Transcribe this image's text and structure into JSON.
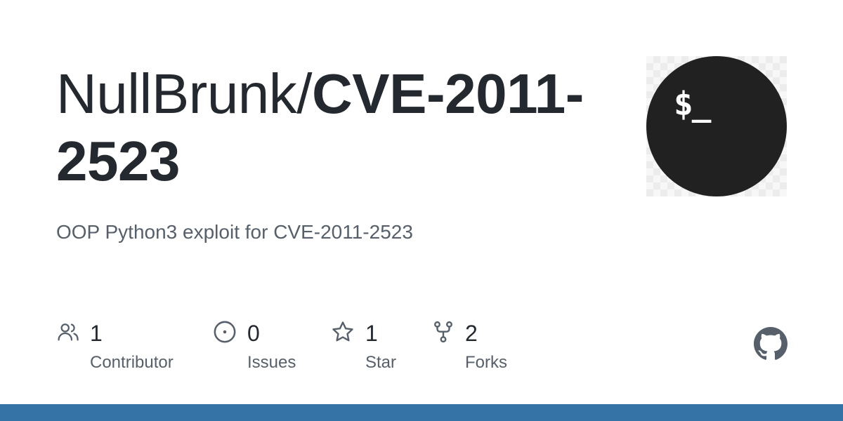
{
  "repo": {
    "owner": "NullBrunk/",
    "name": "CVE-2011-2523",
    "description": "OOP Python3 exploit for CVE-2011-2523"
  },
  "avatar": {
    "text": "$_",
    "background_color": "#212121"
  },
  "stats": [
    {
      "icon": "people-icon",
      "count": "1",
      "label": "Contributor"
    },
    {
      "icon": "issue-opened-icon",
      "count": "0",
      "label": "Issues"
    },
    {
      "icon": "star-icon",
      "count": "1",
      "label": "Star"
    },
    {
      "icon": "repo-forked-icon",
      "count": "2",
      "label": "Forks"
    }
  ],
  "logo": {
    "icon": "github-mark-icon"
  },
  "colors": {
    "language_bar": "#3572a5",
    "text_primary": "#24292f",
    "text_secondary": "#57606a"
  }
}
